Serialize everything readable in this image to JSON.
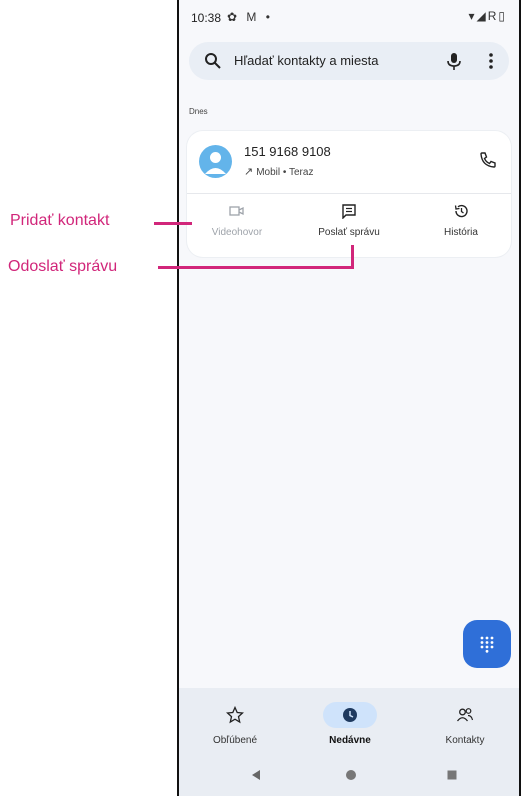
{
  "status_bar": {
    "time": "10:38",
    "left_icons": "✿ M •",
    "right_icons": "▾◢R▯"
  },
  "search": {
    "placeholder": "Hľadať kontakty a miesta"
  },
  "section_label": "Dnes",
  "call_entry": {
    "number": "151 9168 9108",
    "arrow": "↗",
    "detail": "Mobil • Teraz"
  },
  "actions": [
    {
      "label": "Videohovor",
      "icon": "video-icon",
      "enabled": false
    },
    {
      "label": "Poslať správu",
      "icon": "message-icon",
      "enabled": true
    },
    {
      "label": "História",
      "icon": "history-icon",
      "enabled": true
    }
  ],
  "bottom_nav": [
    {
      "label": "Obľúbené",
      "icon": "star-icon",
      "active": false
    },
    {
      "label": "Nedávne",
      "icon": "clock-icon",
      "active": true
    },
    {
      "label": "Kontakty",
      "icon": "people-icon",
      "active": false
    }
  ],
  "callouts": {
    "add_contact": "Pridať kontakt",
    "send_message": "Odoslať správu"
  },
  "colors": {
    "accent": "#2f6fd8",
    "callout": "#d1267a",
    "avatar": "#63b4ea",
    "active_pill": "#cfe3fb"
  }
}
